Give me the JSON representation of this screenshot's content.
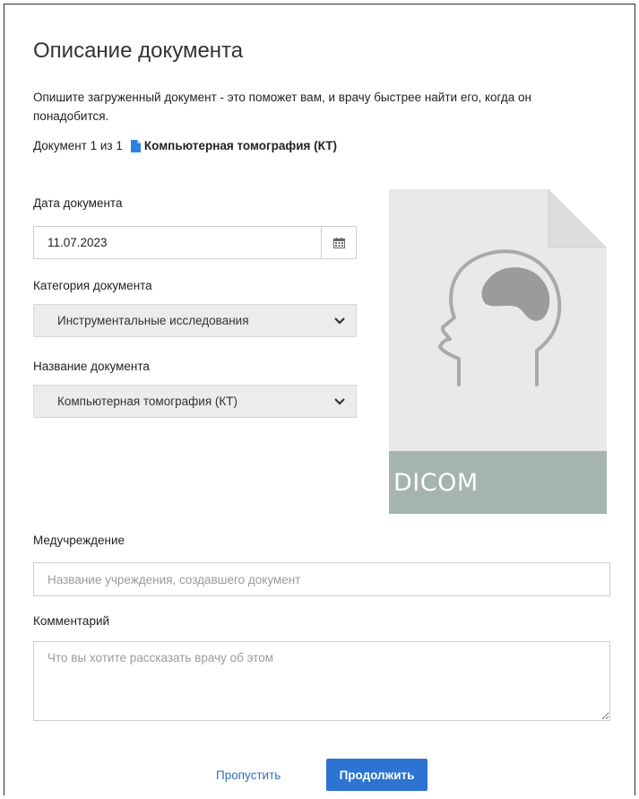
{
  "dialog": {
    "title": "Описание документа",
    "intro": "Опишите загруженный документ - это поможет вам, и врачу быстрее найти его, когда он понадобится.",
    "counter": "Документ 1 из 1",
    "document_name": "Компьютерная томография (КТ)"
  },
  "form": {
    "date": {
      "label": "Дата документа",
      "value": "11.07.2023",
      "icon": "calendar-icon"
    },
    "category": {
      "label": "Категория документа",
      "selected": "Инструментальные исследования",
      "icon": "chevron-down-icon"
    },
    "name": {
      "label": "Название документа",
      "selected": "Компьютерная томография (КТ)",
      "icon": "chevron-down-icon"
    },
    "institution": {
      "label": "Медучреждение",
      "value": "",
      "placeholder": "Название учреждения, создавшего документ"
    },
    "comment": {
      "label": "Комментарий",
      "value": "",
      "placeholder": "Что вы хотите рассказать врачу об этом"
    }
  },
  "preview": {
    "format": "DICOM",
    "icon": "head-profile-icon"
  },
  "actions": {
    "skip": "Пропустить",
    "continue": "Продолжить"
  },
  "colors": {
    "accent": "#2c73d2",
    "link": "#2f6fc0",
    "preview_bg": "#e9e9e9",
    "preview_band": "#a5b3b1"
  }
}
